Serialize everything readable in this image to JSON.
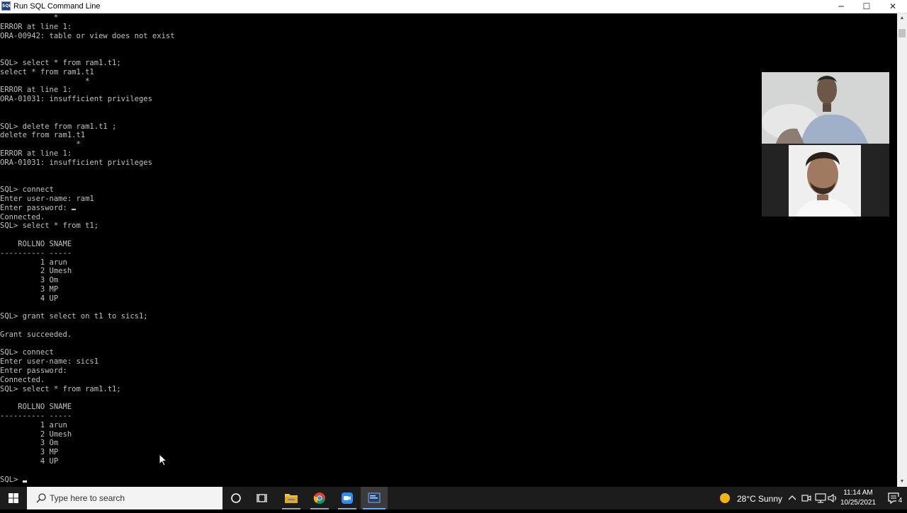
{
  "window": {
    "title": "Run SQL Command Line",
    "icon_label": "SQL",
    "min_label": "─",
    "max_label": "☐",
    "close_label": "✕"
  },
  "console": {
    "text": "            *\nERROR at line 1:\nORA-00942: table or view does not exist\n\n\nSQL> select * from ram1.t1;\nselect * from ram1.t1\n                   *\nERROR at line 1:\nORA-01031: insufficient privileges\n\n\nSQL> delete from ram1.t1 ;\ndelete from ram1.t1\n                 *\nERROR at line 1:\nORA-01031: insufficient privileges\n\n\nSQL> connect\nEnter user-name: ram1\nEnter password: ",
    "text2": "\nConnected.\nSQL> select * from t1;\n\n    ROLLNO SNAME\n---------- -----\n         1 arun\n         2 Umesh\n         3 Om\n         3 MP\n         4 UP\n\nSQL> grant select on t1 to sics1;\n\nGrant succeeded.\n\nSQL> connect\nEnter user-name: sics1\nEnter password:\nConnected.\nSQL> select * from ram1.t1;\n\n    ROLLNO SNAME\n---------- -----\n         1 arun\n         2 Umesh\n         3 Om\n         3 MP\n         4 UP\n\n",
    "prompt": "SQL> "
  },
  "scrollbar": {
    "up_arrow": "▲",
    "down_arrow": "▼"
  },
  "taskbar": {
    "search_placeholder": "Type here to search",
    "weather_temp": "28°C",
    "weather_desc": "Sunny",
    "time": "11:14 AM",
    "date": "10/25/2021",
    "notification_count": "4",
    "accent_color": "#6aa7ff",
    "icons": [
      "windows-logo-icon",
      "search-icon",
      "cortana-circle-icon",
      "task-view-icon",
      "file-explorer-icon",
      "chrome-icon",
      "zoom-icon",
      "sql-command-line-icon",
      "sun-icon",
      "chevron-up-icon",
      "meet-now-icon",
      "network-icon",
      "volume-icon",
      "notification-icon"
    ]
  }
}
